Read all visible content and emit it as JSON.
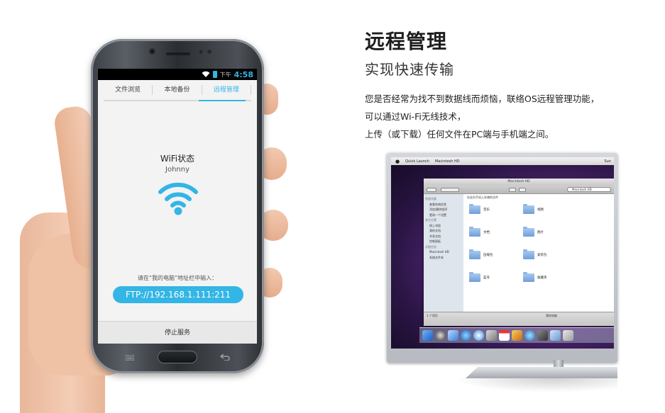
{
  "phone": {
    "status_period": "下午",
    "status_time": "4:58",
    "tabs": [
      {
        "label": "文件浏览",
        "active": false
      },
      {
        "label": "本地备份",
        "active": false
      },
      {
        "label": "远程管理",
        "active": true
      }
    ],
    "wifi_title": "WiFi状态",
    "wifi_name": "Johnny",
    "hint": "请在“我的电脑”地址栏中输入：",
    "ftp_address": "FTP://192.168.1.111:211",
    "stop_label": "停止服务"
  },
  "feature": {
    "title": "远程管理",
    "subtitle": "实现快速传输",
    "desc_lines": [
      "您是否经常为找不到数据线而烦恼，联络OS远程管理功能，",
      "可以通过Wi-Fi无线技术，",
      "上传（或下载）任何文件在PC端与手机端之间。"
    ]
  },
  "mac": {
    "menubar": [
      "Quick Launch",
      "Macintosh HD"
    ],
    "menubar_right": "Sun",
    "finder_title": "Macintosh HD",
    "search_placeholder": "Macintosh HD",
    "path_label": "在这台手机上存储的文件",
    "sidebar": [
      {
        "text": "系统设备",
        "type": "sec"
      },
      {
        "text": "查看系统信息",
        "type": "itm"
      },
      {
        "text": "添加/删除程序",
        "type": "itm"
      },
      {
        "text": "更改一个设置",
        "type": "itm"
      },
      {
        "text": "其它位置",
        "type": "sec"
      },
      {
        "text": "网上邻居",
        "type": "itm"
      },
      {
        "text": "我的文档",
        "type": "itm"
      },
      {
        "text": "共享文档",
        "type": "itm"
      },
      {
        "text": "控制面板",
        "type": "itm"
      },
      {
        "text": "详细信息",
        "type": "sec"
      },
      {
        "text": "Macintosh HD",
        "type": "itm"
      },
      {
        "text": "系统文件夹",
        "type": "itm"
      }
    ],
    "folders": [
      "音乐",
      "视频",
      "文档",
      "图片",
      "压缩包",
      "安装包",
      "蓝牙",
      "收藏夹"
    ],
    "status_left": "1 个项目",
    "status_right": "我的电脑"
  },
  "colors": {
    "accent": "#33b5e5",
    "phone_screen_bg": "#f3f3f3"
  }
}
